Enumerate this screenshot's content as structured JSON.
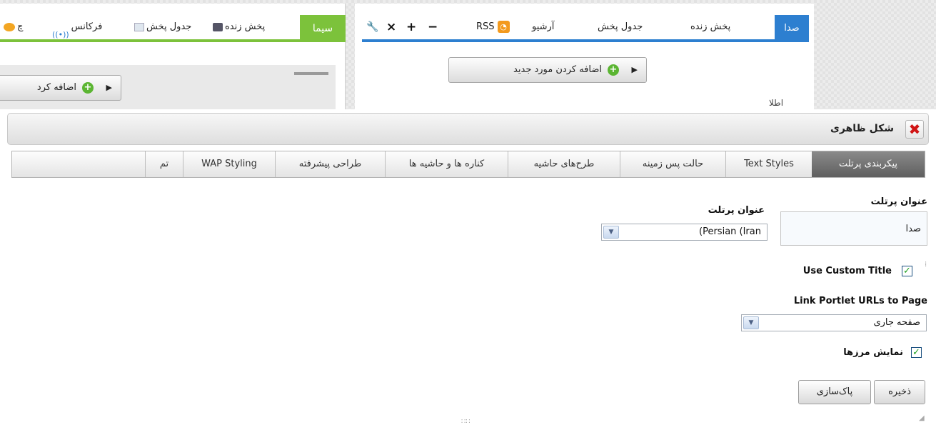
{
  "left_portlet": {
    "active_tab": "سیما",
    "tabs": [
      {
        "label": "پخش زنده"
      },
      {
        "label": "جدول پخش"
      },
      {
        "label": "فرکانس"
      },
      {
        "label": "چ"
      }
    ],
    "add_button_label": "اضافه کرد"
  },
  "right_portlet": {
    "active_tab": "صدا",
    "tabs": [
      {
        "label": "پخش زنده"
      },
      {
        "label": "جدول پخش"
      },
      {
        "label": "آرشیو"
      },
      {
        "label": "RSS"
      }
    ],
    "controls": [
      "−",
      "+",
      "×",
      "🔧"
    ],
    "add_button_label": "اضافه کردن مورد جدید",
    "stub_text": "اطلا"
  },
  "dialog": {
    "title": "شکل ظاهری",
    "close_glyph": "✖",
    "tabs": [
      {
        "label": "پیکربندی پرتلت",
        "active": true
      },
      {
        "label": "Text Styles",
        "active": false
      },
      {
        "label": "حالت پس زمینه",
        "active": false
      },
      {
        "label": "طرح‌های حاشیه",
        "active": false
      },
      {
        "label": "کناره ها و حاشیه ها",
        "active": false
      },
      {
        "label": "طراحی پیشرفته",
        "active": false
      },
      {
        "label": "WAP Styling",
        "active": false
      },
      {
        "label": "تم",
        "active": false
      }
    ],
    "form": {
      "portlet_title_label": "عنوان پرتلت",
      "portlet_title_value": "صدا",
      "language_label": "عنوان پرتلت",
      "language_value": "(Persian (Iran",
      "use_custom_title_label": "Use Custom Title",
      "use_custom_title_checked": true,
      "link_urls_label": "Link Portlet URLs to Page",
      "link_urls_value": "صفحه جاری",
      "show_borders_label": "نمایش مرزها",
      "show_borders_checked": true,
      "save_button": "ذخیره",
      "reset_button": "پاک‌سازی"
    }
  },
  "colors": {
    "left_accent": "#7cc23b",
    "right_accent": "#2d7fd0",
    "close_red": "#d01515"
  }
}
